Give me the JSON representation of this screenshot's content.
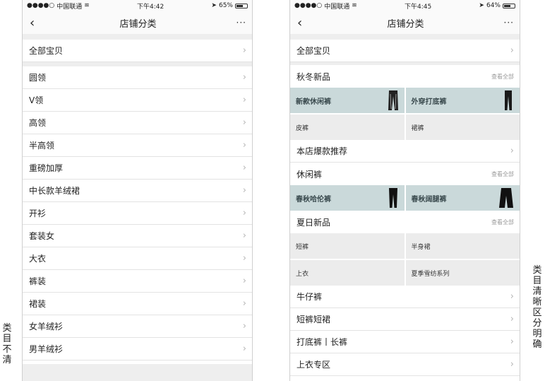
{
  "status": {
    "carrier": "中国联通",
    "left": {
      "time": "下午4:42",
      "battery": "65%",
      "battery_frac": 0.65
    },
    "right": {
      "time": "下午4:45",
      "battery": "64%",
      "battery_frac": 0.64
    }
  },
  "nav": {
    "title": "店铺分类",
    "more": "···"
  },
  "left": {
    "all": "全部宝贝",
    "items": [
      "圆领",
      "V领",
      "高领",
      "半高领",
      "重磅加厚",
      "中长款羊绒裙",
      "开衫",
      "套装女",
      "大衣",
      "裤装",
      "裙装",
      "女羊绒衫",
      "男羊绒衫"
    ]
  },
  "right": {
    "all": "全部宝贝",
    "view_all": "查看全部",
    "sec1": {
      "title": "秋冬新品",
      "feat": [
        "新款休闲裤",
        "外穿打底裤"
      ],
      "plain": [
        "皮裤",
        "裙裤"
      ]
    },
    "hot": "本店爆款推荐",
    "sec2": {
      "title": "休闲裤",
      "feat": [
        "春秋哈伦裤",
        "春秋阔腿裤"
      ]
    },
    "sec3": {
      "title": "夏日新品",
      "plain": [
        "短裤",
        "半身裙",
        "上衣",
        "夏季雪纺系列"
      ]
    },
    "tail": [
      "牛仔裤",
      "短裤短裙",
      "打底裤丨长裤",
      "上衣专区"
    ]
  },
  "labels": {
    "left": "类目不清",
    "right": "类目清晰区分明确"
  }
}
